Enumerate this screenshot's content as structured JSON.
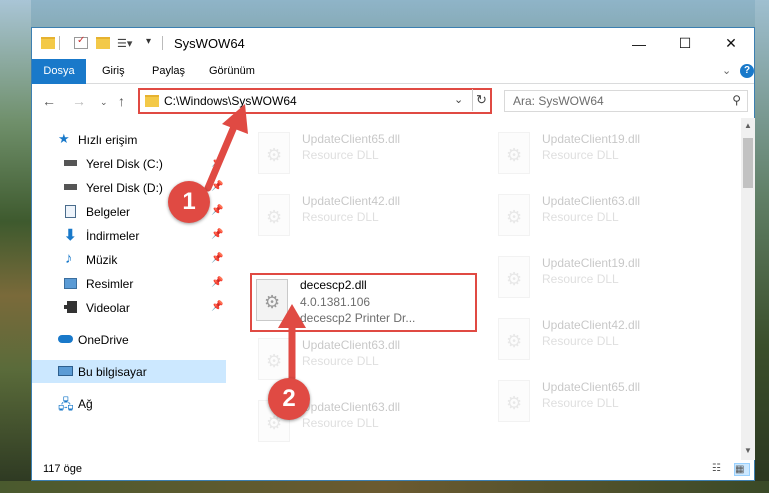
{
  "window": {
    "title": "SysWOW64"
  },
  "ribbon": {
    "tabs": [
      {
        "label": "Dosya",
        "active": true
      },
      {
        "label": "Giriş",
        "active": false
      },
      {
        "label": "Paylaş",
        "active": false
      },
      {
        "label": "Görünüm",
        "active": false
      }
    ],
    "help_label": "?"
  },
  "nav": {
    "address": "C:\\Windows\\SysWOW64",
    "search_placeholder": "Ara: SysWOW64"
  },
  "sidebar": {
    "items": [
      {
        "label": "Hızlı erişim",
        "icon": "star-icon",
        "pinned": false,
        "selected": false
      },
      {
        "label": "Yerel Disk (C:)",
        "icon": "drive-icon",
        "pinned": true,
        "selected": false
      },
      {
        "label": "Yerel Disk (D:)",
        "icon": "drive-icon",
        "pinned": true,
        "selected": false
      },
      {
        "label": "Belgeler",
        "icon": "documents-icon",
        "pinned": true,
        "selected": false
      },
      {
        "label": "İndirmeler",
        "icon": "download-icon",
        "pinned": true,
        "selected": false
      },
      {
        "label": "Müzik",
        "icon": "music-icon",
        "pinned": true,
        "selected": false
      },
      {
        "label": "Resimler",
        "icon": "pictures-icon",
        "pinned": true,
        "selected": false
      },
      {
        "label": "Videolar",
        "icon": "videos-icon",
        "pinned": true,
        "selected": false
      },
      {
        "label": "OneDrive",
        "icon": "cloud-icon",
        "pinned": false,
        "selected": false
      },
      {
        "label": "Bu bilgisayar",
        "icon": "computer-icon",
        "pinned": false,
        "selected": true
      },
      {
        "label": "Ağ",
        "icon": "network-icon",
        "pinned": false,
        "selected": false
      }
    ]
  },
  "files": {
    "left": [
      {
        "name": "UpdateClient65.dll",
        "line2": "Resource DLL",
        "line3": ""
      },
      {
        "name": "UpdateClient42.dll",
        "line2": "Resource DLL",
        "line3": ""
      },
      {
        "name": "decescp2.dll",
        "line2": "4.0.1381.106",
        "line3": "decescp2 Printer Dr..."
      },
      {
        "name": "UpdateClient63.dll",
        "line2": "Resource DLL",
        "line3": ""
      },
      {
        "name": "UpdateClient63.dll",
        "line2": "Resource DLL",
        "line3": ""
      }
    ],
    "right": [
      {
        "name": "UpdateClient19.dll",
        "line2": "Resource DLL"
      },
      {
        "name": "UpdateClient63.dll",
        "line2": "Resource DLL"
      },
      {
        "name": "UpdateClient19.dll",
        "line2": "Resource DLL"
      },
      {
        "name": "UpdateClient42.dll",
        "line2": "Resource DLL"
      },
      {
        "name": "UpdateClient65.dll",
        "line2": "Resource DLL"
      }
    ]
  },
  "status": {
    "item_count": "117 öge"
  },
  "annotations": {
    "step1": "1",
    "step2": "2",
    "color": "#e04a43"
  }
}
